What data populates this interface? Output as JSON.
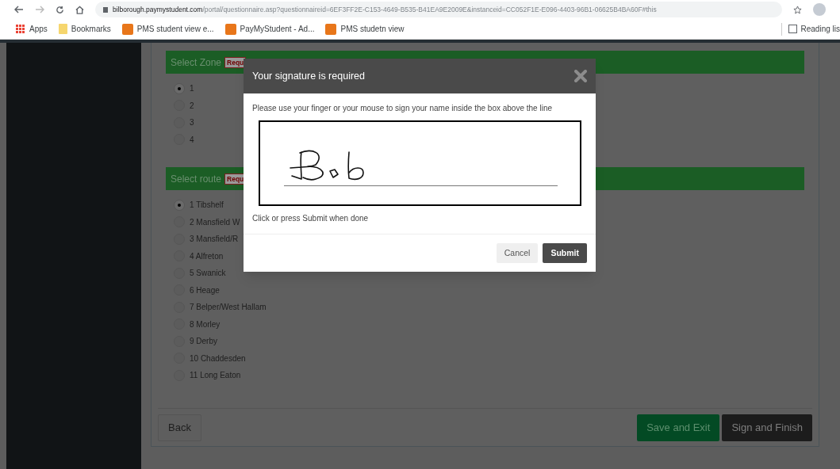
{
  "browser": {
    "url_host": "bilborough.paymystudent.com",
    "url_path": "/portal/questionnaire.asp?questionnaireid=6EF3FF2E-C153-4649-B535-B41EA9E2009E&instanceid=CC052F1E-E096-4403-96B1-06625B4BA60F#this",
    "bookmarks": [
      {
        "label": "Apps",
        "kind": "apps"
      },
      {
        "label": "Bookmarks",
        "kind": "folder"
      },
      {
        "label": "PMS student view e...",
        "kind": "site"
      },
      {
        "label": "PayMyStudent - Ad...",
        "kind": "site"
      },
      {
        "label": "PMS studetn view",
        "kind": "site"
      }
    ],
    "reading_list": "Reading lis"
  },
  "sections": [
    {
      "title": "Select Zone",
      "badge": "Requ",
      "options": [
        {
          "label": "1",
          "selected": true
        },
        {
          "label": "2",
          "selected": false
        },
        {
          "label": "3",
          "selected": false
        },
        {
          "label": "4",
          "selected": false
        }
      ]
    },
    {
      "title": "Select route",
      "badge": "Requ",
      "options": [
        {
          "label": "1 Tibshelf",
          "selected": true
        },
        {
          "label": "2 Mansfield W",
          "selected": false
        },
        {
          "label": "3 Mansfield/R",
          "selected": false
        },
        {
          "label": "4 Alfreton",
          "selected": false
        },
        {
          "label": "5 Swanick",
          "selected": false
        },
        {
          "label": "6 Heage",
          "selected": false
        },
        {
          "label": "7 Belper/West Hallam",
          "selected": false
        },
        {
          "label": "8 Morley",
          "selected": false
        },
        {
          "label": "9 Derby",
          "selected": false
        },
        {
          "label": "10 Chaddesden",
          "selected": false
        },
        {
          "label": "11 Long Eaton",
          "selected": false
        }
      ]
    }
  ],
  "footer": {
    "back": "Back",
    "save": "Save and Exit",
    "finish": "Sign and Finish"
  },
  "modal": {
    "title": "Your signature is required",
    "instruction": "Please use your finger or your mouse to sign your name inside the box above the line",
    "hint": "Click or press Submit when done",
    "cancel": "Cancel",
    "submit": "Submit"
  }
}
